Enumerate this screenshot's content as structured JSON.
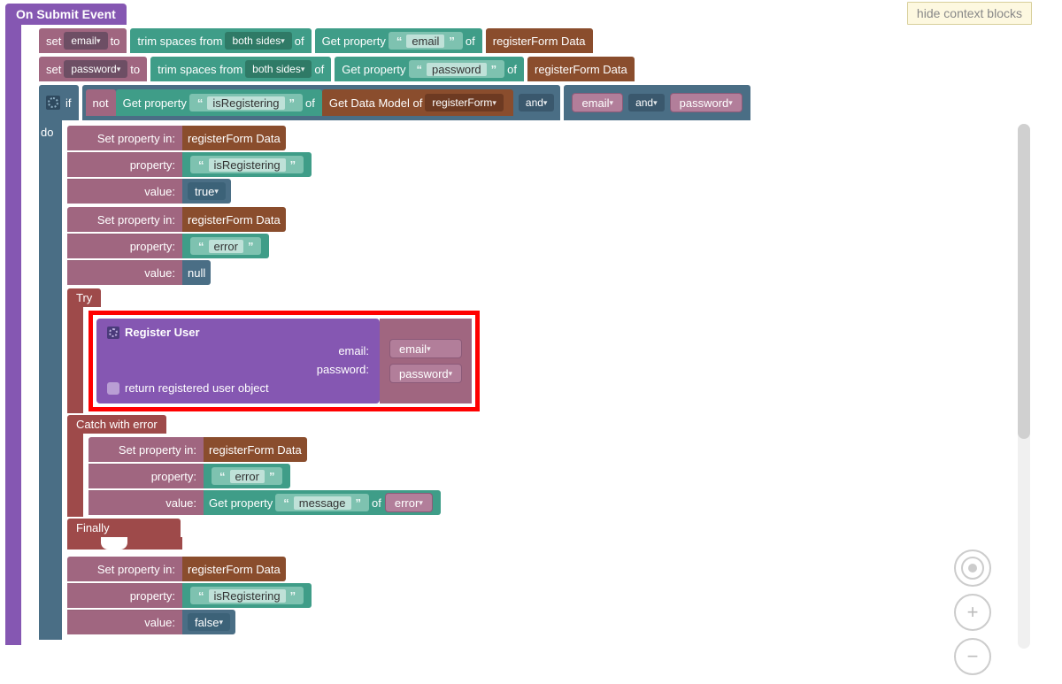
{
  "ui": {
    "hideContext": "hide context blocks"
  },
  "event": {
    "title": "On Submit Event"
  },
  "setEmail": {
    "set": "set",
    "var": "email",
    "to": "to",
    "trim": "trim spaces from",
    "sides": "both sides",
    "of": "of",
    "getProp": "Get property",
    "prop": "email",
    "of2": "of",
    "obj": "registerForm Data"
  },
  "setPassword": {
    "set": "set",
    "var": "password",
    "to": "to",
    "trim": "trim spaces from",
    "sides": "both sides",
    "of": "of",
    "getProp": "Get property",
    "prop": "password",
    "of2": "of",
    "obj": "registerForm Data"
  },
  "ifRow": {
    "if": "if",
    "not": "not",
    "getProp": "Get property",
    "prop": "isRegistering",
    "of": "of",
    "getModel": "Get Data Model of",
    "model": "registerForm",
    "and1": "and",
    "emailVar": "email",
    "and2": "and",
    "passVar": "password"
  },
  "doLabel": "do",
  "setProp1": {
    "label": "Set property in:",
    "obj": "registerForm Data",
    "propLabel": "property:",
    "prop": "isRegistering",
    "valLabel": "value:",
    "val": "true"
  },
  "setProp2": {
    "label": "Set property in:",
    "obj": "registerForm Data",
    "propLabel": "property:",
    "prop": "error",
    "valLabel": "value:",
    "val": "null"
  },
  "tryLabel": "Try",
  "register": {
    "title": "Register User",
    "emailLabel": "email:",
    "emailVar": "email",
    "passLabel": "password:",
    "passVar": "password",
    "ret": "return registered user object"
  },
  "catchLabel": "Catch with error",
  "setProp3": {
    "label": "Set property in:",
    "obj": "registerForm Data",
    "propLabel": "property:",
    "prop": "error",
    "valLabel": "value:"
  },
  "catchVal": {
    "getProp": "Get property",
    "prop": "message",
    "of": "of",
    "var": "error"
  },
  "finallyLabel": "Finally",
  "setProp4": {
    "label": "Set property in:",
    "obj": "registerForm Data",
    "propLabel": "property:",
    "prop": "isRegistering",
    "valLabel": "value:",
    "val": "false"
  }
}
